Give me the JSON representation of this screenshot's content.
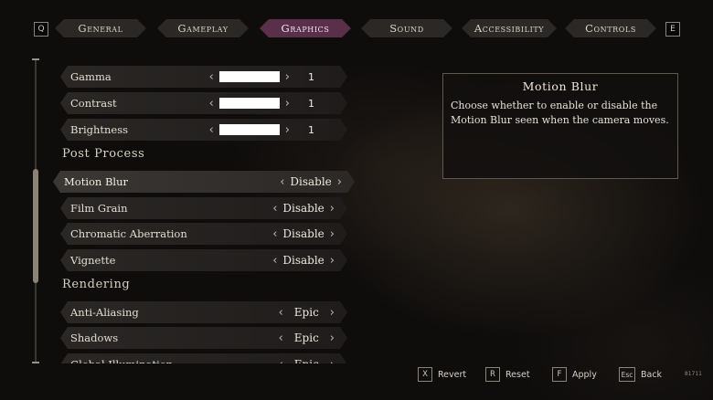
{
  "nav": {
    "left_key": "Q",
    "right_key": "E",
    "tabs": [
      {
        "label": "General",
        "active": false
      },
      {
        "label": "Gameplay",
        "active": false
      },
      {
        "label": "Graphics",
        "active": true
      },
      {
        "label": "Sound",
        "active": false
      },
      {
        "label": "Accessibility",
        "active": false
      },
      {
        "label": "Controls",
        "active": false
      }
    ]
  },
  "settings": {
    "gamma": {
      "label": "Gamma",
      "value": "1"
    },
    "contrast": {
      "label": "Contrast",
      "value": "1"
    },
    "brightness": {
      "label": "Brightness",
      "value": "1"
    },
    "post_process_title": "Post Process",
    "motion_blur": {
      "label": "Motion Blur",
      "value": "Disable"
    },
    "film_grain": {
      "label": "Film Grain",
      "value": "Disable"
    },
    "chromatic_aberration": {
      "label": "Chromatic Aberration",
      "value": "Disable"
    },
    "vignette": {
      "label": "Vignette",
      "value": "Disable"
    },
    "rendering_title": "Rendering",
    "anti_aliasing": {
      "label": "Anti-Aliasing",
      "value": "Epic"
    },
    "shadows": {
      "label": "Shadows",
      "value": "Epic"
    },
    "global_illumination": {
      "label": "Global Illumination",
      "value": "Epic"
    }
  },
  "info": {
    "title": "Motion Blur",
    "body": "Choose whether to enable or disable the Motion Blur seen when the camera moves."
  },
  "footer": {
    "revert": {
      "key": "X",
      "label": "Revert"
    },
    "reset": {
      "key": "R",
      "label": "Reset"
    },
    "apply": {
      "key": "F",
      "label": "Apply"
    },
    "back": {
      "key": "Esc",
      "label": "Back"
    },
    "build": "81711"
  },
  "icons": {
    "left_chevron": "chevron-left-icon",
    "right_chevron": "chevron-right-icon"
  },
  "colors": {
    "active_tab": "#5a2f4a",
    "background": "#0f0d0c",
    "panel_border": "#5e5850"
  }
}
